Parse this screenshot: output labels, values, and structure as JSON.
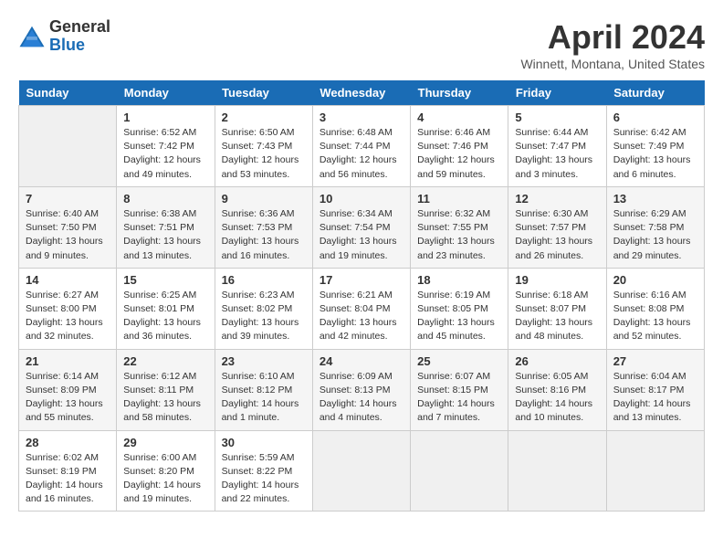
{
  "header": {
    "logo_general": "General",
    "logo_blue": "Blue",
    "title": "April 2024",
    "location": "Winnett, Montana, United States"
  },
  "days_of_week": [
    "Sunday",
    "Monday",
    "Tuesday",
    "Wednesday",
    "Thursday",
    "Friday",
    "Saturday"
  ],
  "weeks": [
    [
      {
        "day": "",
        "empty": true
      },
      {
        "day": "1",
        "sunrise": "Sunrise: 6:52 AM",
        "sunset": "Sunset: 7:42 PM",
        "daylight": "Daylight: 12 hours and 49 minutes."
      },
      {
        "day": "2",
        "sunrise": "Sunrise: 6:50 AM",
        "sunset": "Sunset: 7:43 PM",
        "daylight": "Daylight: 12 hours and 53 minutes."
      },
      {
        "day": "3",
        "sunrise": "Sunrise: 6:48 AM",
        "sunset": "Sunset: 7:44 PM",
        "daylight": "Daylight: 12 hours and 56 minutes."
      },
      {
        "day": "4",
        "sunrise": "Sunrise: 6:46 AM",
        "sunset": "Sunset: 7:46 PM",
        "daylight": "Daylight: 12 hours and 59 minutes."
      },
      {
        "day": "5",
        "sunrise": "Sunrise: 6:44 AM",
        "sunset": "Sunset: 7:47 PM",
        "daylight": "Daylight: 13 hours and 3 minutes."
      },
      {
        "day": "6",
        "sunrise": "Sunrise: 6:42 AM",
        "sunset": "Sunset: 7:49 PM",
        "daylight": "Daylight: 13 hours and 6 minutes."
      }
    ],
    [
      {
        "day": "7",
        "sunrise": "Sunrise: 6:40 AM",
        "sunset": "Sunset: 7:50 PM",
        "daylight": "Daylight: 13 hours and 9 minutes."
      },
      {
        "day": "8",
        "sunrise": "Sunrise: 6:38 AM",
        "sunset": "Sunset: 7:51 PM",
        "daylight": "Daylight: 13 hours and 13 minutes."
      },
      {
        "day": "9",
        "sunrise": "Sunrise: 6:36 AM",
        "sunset": "Sunset: 7:53 PM",
        "daylight": "Daylight: 13 hours and 16 minutes."
      },
      {
        "day": "10",
        "sunrise": "Sunrise: 6:34 AM",
        "sunset": "Sunset: 7:54 PM",
        "daylight": "Daylight: 13 hours and 19 minutes."
      },
      {
        "day": "11",
        "sunrise": "Sunrise: 6:32 AM",
        "sunset": "Sunset: 7:55 PM",
        "daylight": "Daylight: 13 hours and 23 minutes."
      },
      {
        "day": "12",
        "sunrise": "Sunrise: 6:30 AM",
        "sunset": "Sunset: 7:57 PM",
        "daylight": "Daylight: 13 hours and 26 minutes."
      },
      {
        "day": "13",
        "sunrise": "Sunrise: 6:29 AM",
        "sunset": "Sunset: 7:58 PM",
        "daylight": "Daylight: 13 hours and 29 minutes."
      }
    ],
    [
      {
        "day": "14",
        "sunrise": "Sunrise: 6:27 AM",
        "sunset": "Sunset: 8:00 PM",
        "daylight": "Daylight: 13 hours and 32 minutes."
      },
      {
        "day": "15",
        "sunrise": "Sunrise: 6:25 AM",
        "sunset": "Sunset: 8:01 PM",
        "daylight": "Daylight: 13 hours and 36 minutes."
      },
      {
        "day": "16",
        "sunrise": "Sunrise: 6:23 AM",
        "sunset": "Sunset: 8:02 PM",
        "daylight": "Daylight: 13 hours and 39 minutes."
      },
      {
        "day": "17",
        "sunrise": "Sunrise: 6:21 AM",
        "sunset": "Sunset: 8:04 PM",
        "daylight": "Daylight: 13 hours and 42 minutes."
      },
      {
        "day": "18",
        "sunrise": "Sunrise: 6:19 AM",
        "sunset": "Sunset: 8:05 PM",
        "daylight": "Daylight: 13 hours and 45 minutes."
      },
      {
        "day": "19",
        "sunrise": "Sunrise: 6:18 AM",
        "sunset": "Sunset: 8:07 PM",
        "daylight": "Daylight: 13 hours and 48 minutes."
      },
      {
        "day": "20",
        "sunrise": "Sunrise: 6:16 AM",
        "sunset": "Sunset: 8:08 PM",
        "daylight": "Daylight: 13 hours and 52 minutes."
      }
    ],
    [
      {
        "day": "21",
        "sunrise": "Sunrise: 6:14 AM",
        "sunset": "Sunset: 8:09 PM",
        "daylight": "Daylight: 13 hours and 55 minutes."
      },
      {
        "day": "22",
        "sunrise": "Sunrise: 6:12 AM",
        "sunset": "Sunset: 8:11 PM",
        "daylight": "Daylight: 13 hours and 58 minutes."
      },
      {
        "day": "23",
        "sunrise": "Sunrise: 6:10 AM",
        "sunset": "Sunset: 8:12 PM",
        "daylight": "Daylight: 14 hours and 1 minute."
      },
      {
        "day": "24",
        "sunrise": "Sunrise: 6:09 AM",
        "sunset": "Sunset: 8:13 PM",
        "daylight": "Daylight: 14 hours and 4 minutes."
      },
      {
        "day": "25",
        "sunrise": "Sunrise: 6:07 AM",
        "sunset": "Sunset: 8:15 PM",
        "daylight": "Daylight: 14 hours and 7 minutes."
      },
      {
        "day": "26",
        "sunrise": "Sunrise: 6:05 AM",
        "sunset": "Sunset: 8:16 PM",
        "daylight": "Daylight: 14 hours and 10 minutes."
      },
      {
        "day": "27",
        "sunrise": "Sunrise: 6:04 AM",
        "sunset": "Sunset: 8:17 PM",
        "daylight": "Daylight: 14 hours and 13 minutes."
      }
    ],
    [
      {
        "day": "28",
        "sunrise": "Sunrise: 6:02 AM",
        "sunset": "Sunset: 8:19 PM",
        "daylight": "Daylight: 14 hours and 16 minutes."
      },
      {
        "day": "29",
        "sunrise": "Sunrise: 6:00 AM",
        "sunset": "Sunset: 8:20 PM",
        "daylight": "Daylight: 14 hours and 19 minutes."
      },
      {
        "day": "30",
        "sunrise": "Sunrise: 5:59 AM",
        "sunset": "Sunset: 8:22 PM",
        "daylight": "Daylight: 14 hours and 22 minutes."
      },
      {
        "day": "",
        "empty": true
      },
      {
        "day": "",
        "empty": true
      },
      {
        "day": "",
        "empty": true
      },
      {
        "day": "",
        "empty": true
      }
    ]
  ]
}
